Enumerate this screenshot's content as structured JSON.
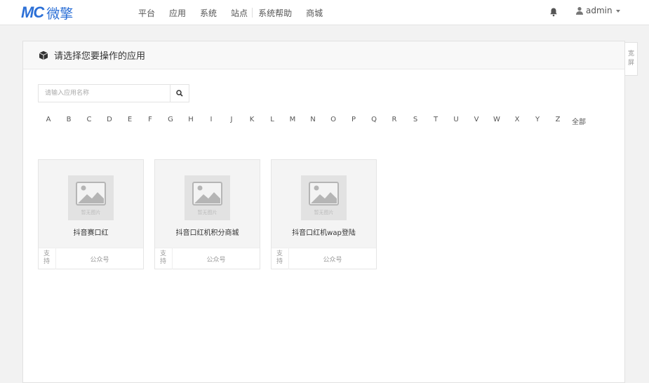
{
  "header": {
    "logo_mark": "MC",
    "logo_text": "微擎",
    "nav": [
      "平台",
      "应用",
      "系统",
      "站点",
      "系统帮助",
      "商城"
    ],
    "user": "admin"
  },
  "panel": {
    "title": "请选择您要操作的应用",
    "side_tab": [
      "宽",
      "屏"
    ]
  },
  "search": {
    "placeholder": "请输入应用名称"
  },
  "letters": [
    "A",
    "B",
    "C",
    "D",
    "E",
    "F",
    "G",
    "H",
    "I",
    "J",
    "K",
    "L",
    "M",
    "N",
    "O",
    "P",
    "Q",
    "R",
    "S",
    "T",
    "U",
    "V",
    "W",
    "X",
    "Y",
    "Z",
    "全部"
  ],
  "cards": [
    {
      "image_caption": "暂无图片",
      "name": "抖音赛口红",
      "support_label": "支持",
      "type": "公众号"
    },
    {
      "image_caption": "暂无图片",
      "name": "抖音口红机积分商城",
      "support_label": "支持",
      "type": "公众号"
    },
    {
      "image_caption": "暂无图片",
      "name": "抖音口红机wap登陆",
      "support_label": "支持",
      "type": "公众号"
    }
  ],
  "colors": {
    "brand": "#2b6fd6"
  }
}
